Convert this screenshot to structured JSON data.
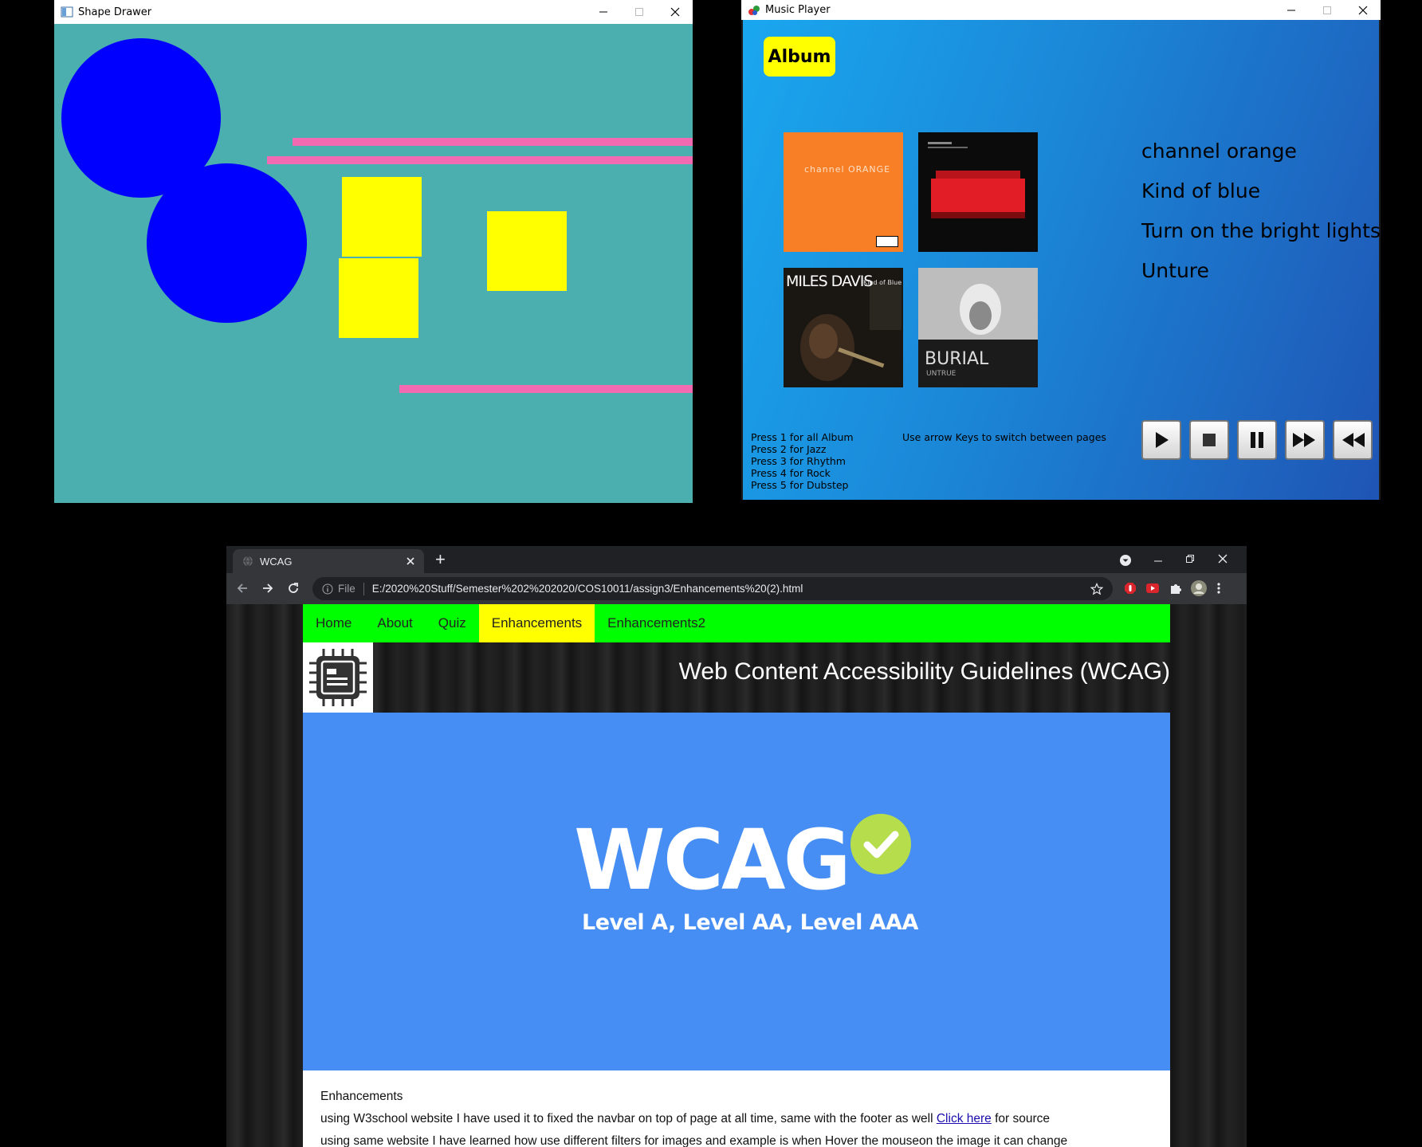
{
  "shape_drawer": {
    "title": "Shape Drawer",
    "colors": {
      "background": "#4aafae",
      "circle": "#0000ff",
      "rectangle": "#ffff00",
      "line": "#f26ab1"
    },
    "shapes": {
      "circles": 2,
      "rectangles": 3,
      "lines": 3
    }
  },
  "music_player": {
    "title": "Music Player",
    "album_button": "Album",
    "covers": [
      {
        "name": "channel-orange-cover",
        "text": "channel ORANGE",
        "bg": "#f97f26"
      },
      {
        "name": "turn-on-the-bright-lights-cover",
        "text": "",
        "bg": "#0b0b0b"
      },
      {
        "name": "kind-of-blue-cover",
        "text": "MILES DAVIS",
        "sub": "Kind of Blue",
        "bg": "#1a1712"
      },
      {
        "name": "untrue-cover",
        "text": "BURIAL",
        "sub": "UNTRUE",
        "bg": "#2b2b2b"
      }
    ],
    "tracks": [
      "channel orange",
      "Kind of blue",
      "Turn on the bright lights",
      "Unture"
    ],
    "help_lines": [
      "Press 1 for all Album",
      "Press 2 for Jazz",
      "Press 3 for Rhythm",
      "Press 4 for Rock",
      "Press 5 for Dubstep"
    ],
    "arrow_hint": "Use arrow Keys to switch between pages",
    "controls": [
      "play-icon",
      "stop-icon",
      "pause-icon",
      "fast-forward-icon",
      "rewind-icon"
    ]
  },
  "browser": {
    "tab_title": "WCAG",
    "new_tab": "+",
    "omnibox_scheme": "File",
    "url": "E:/2020%20Stuff/Semester%202%202020/COS10011/assign3/Enhancements%20(2).html",
    "nav": [
      "Home",
      "About",
      "Quiz",
      "Enhancements",
      "Enhancements2"
    ],
    "active_nav": "Enhancements",
    "site_title": "Web Content Accessibility Guidelines (WCAG)",
    "hero": {
      "logo_text": "WCAG",
      "levels": "Level A, Level AA, Level AAA"
    },
    "content": {
      "heading": "Enhancements",
      "para1": "using W3school website I have used it to fixed the navbar on top of page at all time, same with the footer as well",
      "link": "Click here",
      "para1_suffix": "for source",
      "para2": "using same website I have learned how use different filters for images and example is when Hover the mouseon the image it can change"
    }
  }
}
